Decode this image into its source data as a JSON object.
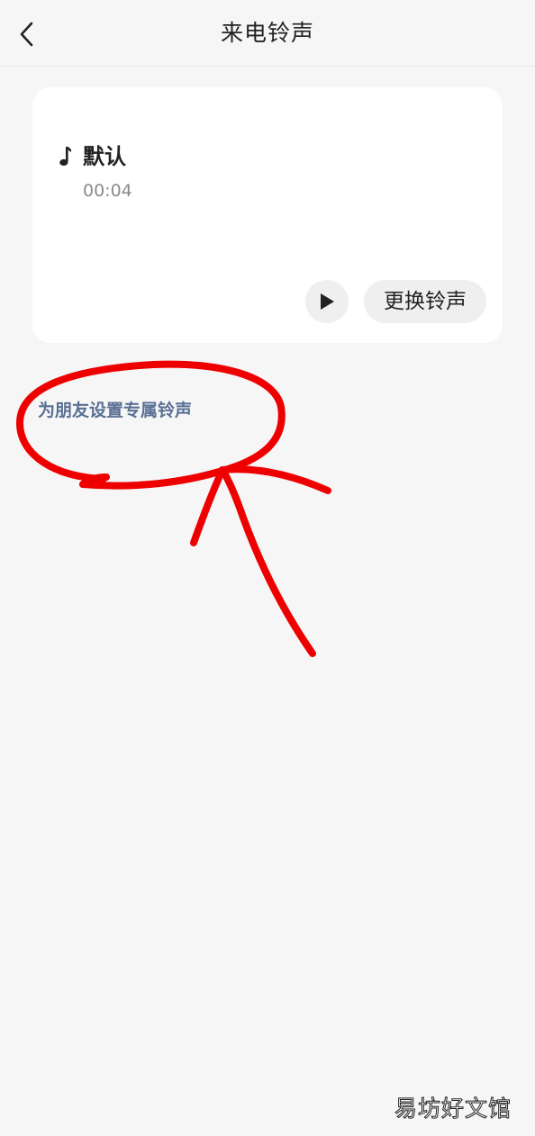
{
  "header": {
    "title": "来电铃声",
    "back_icon": "chevron-left-icon"
  },
  "ringtone_card": {
    "icon": "music-note-icon",
    "name": "默认",
    "duration": "00:04",
    "play_icon": "play-icon",
    "change_label": "更换铃声"
  },
  "friend_link": {
    "label": "为朋友设置专属铃声",
    "color": "#5a6f94"
  },
  "annotation": {
    "color": "#ee0000",
    "shape": "hand-drawn-circle-and-arrow"
  },
  "watermark": {
    "text": "易坊好文馆"
  }
}
